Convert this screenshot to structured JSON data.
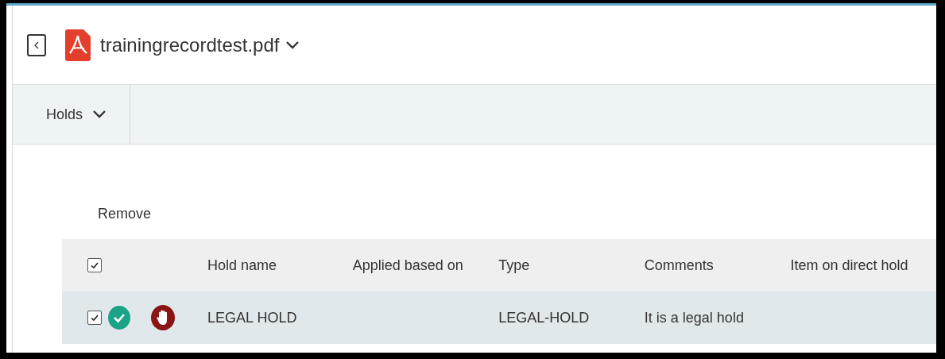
{
  "header": {
    "title": "trainingrecordtest.pdf"
  },
  "toolbar": {
    "menu": "Holds"
  },
  "actions": [
    "Remove"
  ],
  "table": {
    "select_all_checked": true,
    "columns": [
      "Hold name",
      "Applied based on",
      "Type",
      "Comments",
      "Item on direct hold"
    ],
    "rows": [
      {
        "checked": true,
        "selected": true,
        "cells": [
          "LEGAL HOLD",
          "",
          "LEGAL-HOLD",
          "It is a legal hold",
          ""
        ]
      }
    ]
  }
}
